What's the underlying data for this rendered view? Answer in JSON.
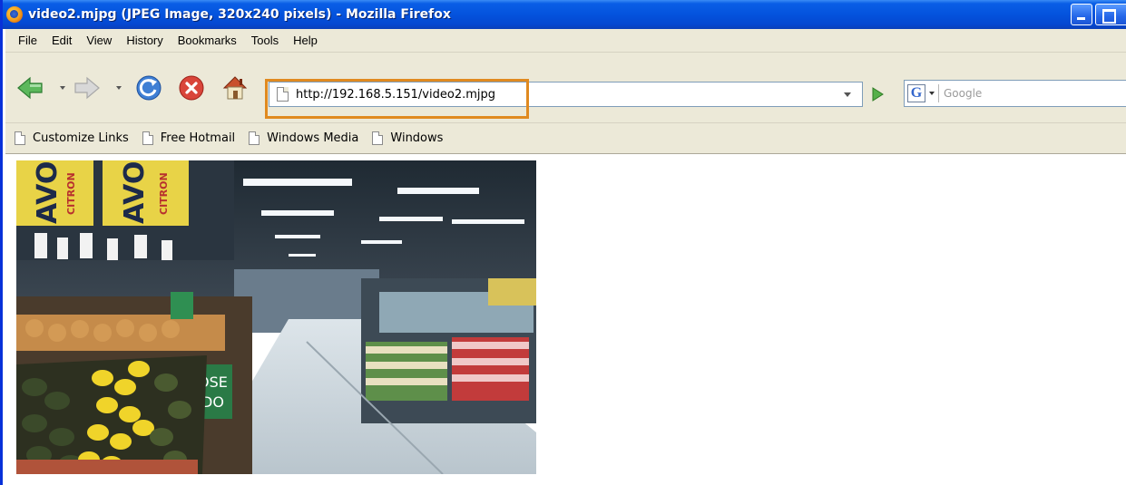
{
  "window": {
    "title": "video2.mjpg (JPEG Image, 320x240 pixels) - Mozilla Firefox"
  },
  "menu": [
    {
      "label": "File"
    },
    {
      "label": "Edit"
    },
    {
      "label": "View"
    },
    {
      "label": "History"
    },
    {
      "label": "Bookmarks"
    },
    {
      "label": "Tools"
    },
    {
      "label": "Help"
    }
  ],
  "nav": {
    "url": "http://192.168.5.151/video2.mjpg",
    "search_engine_letter": "G",
    "search_placeholder": "Google",
    "highlight_color": "#e08a20"
  },
  "bookmarks": [
    {
      "label": "Customize Links"
    },
    {
      "label": "Free Hotmail"
    },
    {
      "label": "Windows Media"
    },
    {
      "label": "Windows"
    }
  ],
  "content": {
    "image_alt": "Supermarket aisle with produce",
    "banner_text_1": "AVOC",
    "banner_sub_1": "CITRON",
    "banner_text_2": "AVOC",
    "banner_sub_2": "CITRON",
    "sign_text_1": "OSE",
    "sign_text_2": "DO"
  }
}
